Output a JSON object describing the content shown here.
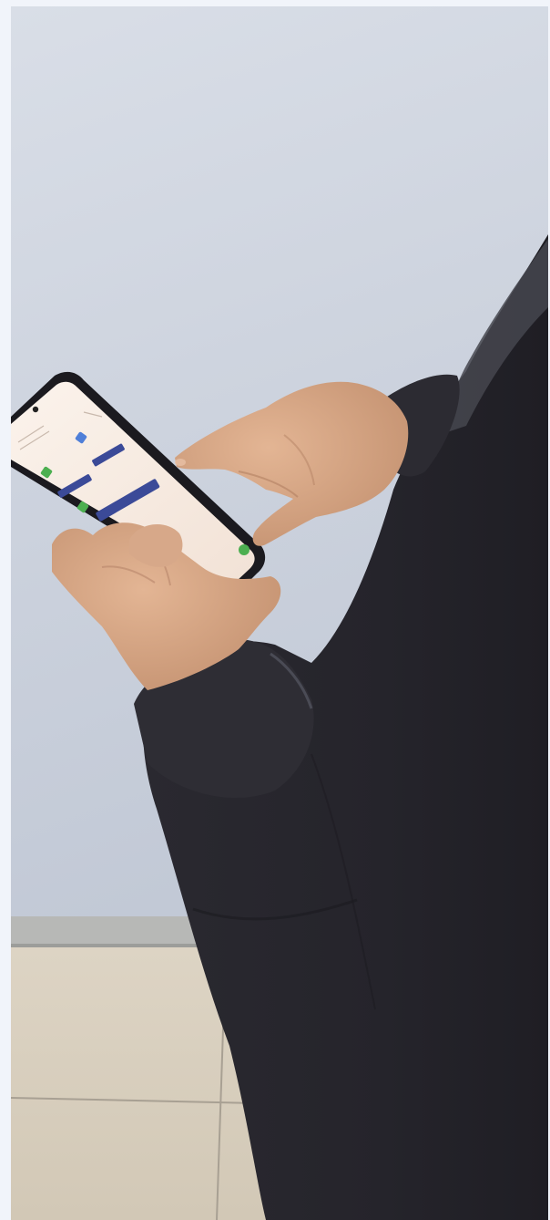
{
  "scene": {
    "description_tokens": [],
    "colors": {
      "wall_top": "#d8dde6",
      "wall_bottom": "#c5ccd8",
      "skirting": "#b9bab8",
      "floor_tile": "#d9d0c0",
      "tile_grout": "#a59e92",
      "jacket": "#2b2a30",
      "jacket_highlight": "#4a4b55",
      "skin": "#d9a987",
      "skin_shadow": "#b98768",
      "phone_body": "#1c1b1f",
      "phone_screen": "#f7ece4",
      "app_button": "#3b4a98",
      "app_icon_green": "#4caf50",
      "app_icon_blue": "#4f7fd8"
    }
  }
}
